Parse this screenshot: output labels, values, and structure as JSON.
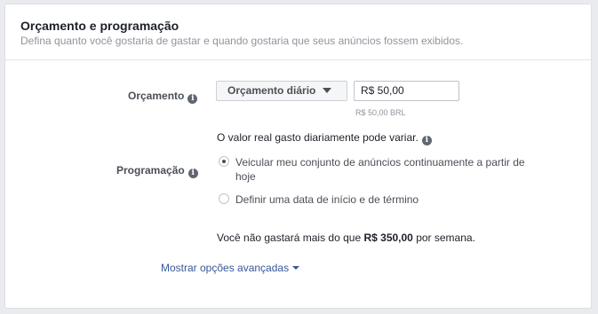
{
  "section": {
    "title": "Orçamento e programação",
    "subtitle": "Defina quanto você gostaria de gastar e quando gostaria que seus anúncios fossem exibidos."
  },
  "budget": {
    "label": "Orçamento",
    "type_selected": "Orçamento diário",
    "amount_value": "R$ 50,00",
    "amount_note": "R$ 50,00 BRL",
    "variation_note": "O valor real gasto diariamente pode variar."
  },
  "schedule": {
    "label": "Programação",
    "options": [
      {
        "label_line1": "Veicular meu conjunto de anúncios continuamente a partir de",
        "label_line2": "hoje",
        "selected": true
      },
      {
        "label": "Definir uma data de início e de término",
        "selected": false
      }
    ]
  },
  "weekly": {
    "prefix": "Você não gastará mais do que",
    "amount": "R$ 350,00",
    "suffix": "por semana."
  },
  "advanced": {
    "label": "Mostrar opções avançadas"
  },
  "icons": {
    "info": "i"
  }
}
